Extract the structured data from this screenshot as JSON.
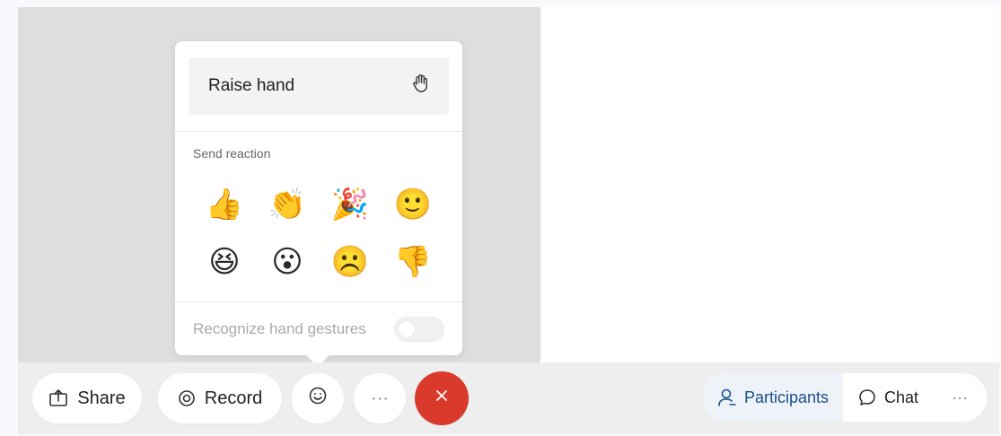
{
  "popup": {
    "raise_hand_label": "Raise hand",
    "raise_hand_icon": "hand-icon",
    "send_reaction_label": "Send reaction",
    "reactions": [
      {
        "name": "thumbs-up",
        "glyph": "👍"
      },
      {
        "name": "clap",
        "glyph": "👏"
      },
      {
        "name": "party",
        "glyph": "🎉"
      },
      {
        "name": "smile",
        "glyph": "🙂"
      },
      {
        "name": "laugh",
        "glyph": "😆"
      },
      {
        "name": "surprised",
        "glyph": "😮"
      },
      {
        "name": "sad",
        "glyph": "☹️"
      },
      {
        "name": "thumbs-down",
        "glyph": "👎"
      }
    ],
    "gesture_label": "Recognize hand gestures",
    "gesture_enabled": false
  },
  "toolbar": {
    "share_label": "Share",
    "record_label": "Record",
    "more_label": "···",
    "end_label": "×",
    "participants_label": "Participants",
    "chat_label": "Chat",
    "more2_label": "···"
  },
  "colors": {
    "end_call": "#d93a2b",
    "accent": "#1a4f8a"
  }
}
